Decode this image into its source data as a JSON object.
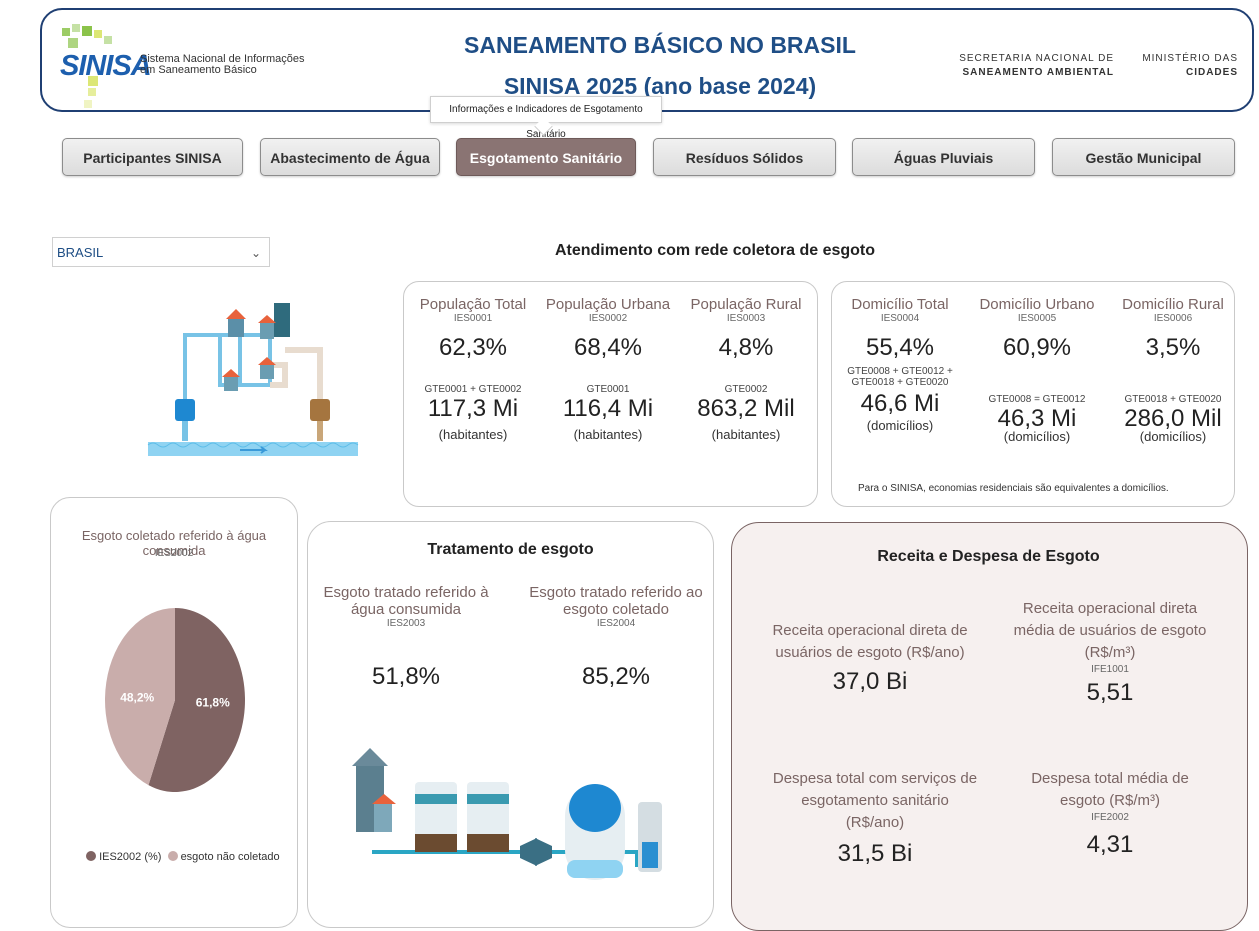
{
  "header": {
    "logo_text": "SINISA",
    "logo_sub1": "Sistema Nacional de Informações",
    "logo_sub2": "em Saneamento Básico",
    "title_line1": "SANEAMENTO BÁSICO NO BRASIL",
    "title_line2": "SINISA 2025 (ano base 2024)",
    "secretaria_line1": "SECRETARIA NACIONAL DE",
    "secretaria_line2": "SANEAMENTO AMBIENTAL",
    "ministerio_line1": "MINISTÉRIO DAS",
    "ministerio_line2": "CIDADES"
  },
  "tooltip": "Informações e Indicadores de Esgotamento Sanitário",
  "tabs": [
    {
      "label": "Participantes SINISA"
    },
    {
      "label": "Abastecimento de Água"
    },
    {
      "label": "Esgotamento Sanitário"
    },
    {
      "label": "Resíduos Sólidos"
    },
    {
      "label": "Águas Pluviais"
    },
    {
      "label": "Gestão Municipal"
    }
  ],
  "filter": {
    "value": "BRASIL"
  },
  "atendimento": {
    "title": "Atendimento com rede coletora de esgoto",
    "populacao": [
      {
        "label": "População Total",
        "code": "IES0001",
        "pct": "62,3%",
        "formula": "GTE0001 + GTE0002",
        "value": "117,3 Mi",
        "unit": "(habitantes)"
      },
      {
        "label": "População Urbana",
        "code": "IES0002",
        "pct": "68,4%",
        "formula": "GTE0001",
        "value": "116,4 Mi",
        "unit": "(habitantes)"
      },
      {
        "label": "População Rural",
        "code": "IES0003",
        "pct": "4,8%",
        "formula": "GTE0002",
        "value": "863,2 Mil",
        "unit": "(habitantes)"
      }
    ],
    "domicilio": [
      {
        "label": "Domicílio Total",
        "code": "IES0004",
        "pct": "55,4%",
        "formula1": "GTE0008 + GTE0012 +",
        "formula2": "GTE0018 + GTE0020",
        "value": "46,6 Mi",
        "unit": "(domicílios)"
      },
      {
        "label": "Domicílio Urbano",
        "code": "IES0005",
        "pct": "60,9%",
        "formula": "GTE0008 = GTE0012",
        "value": "46,3 Mi",
        "unit": "(domicílios)"
      },
      {
        "label": "Domicílio Rural",
        "code": "IES0006",
        "pct": "3,5%",
        "formula": "GTE0018 + GTE0020",
        "value": "286,0 Mil",
        "unit": "(domicílios)"
      }
    ],
    "note": "Para o SINISA, economias residenciais são equivalentes a domicílios."
  },
  "esgoto_coletado": {
    "title": "Esgoto coletado referido à água consumida",
    "code": "IES2002",
    "legend": [
      {
        "label": "IES2002 (%)",
        "color": "#7f6362"
      },
      {
        "label": "esgoto não coletado",
        "color": "#c9adab"
      }
    ]
  },
  "chart_data": {
    "type": "pie",
    "title": "Esgoto coletado referido à água consumida",
    "categories": [
      "IES2002 (%)",
      "esgoto não coletado"
    ],
    "values": [
      61.8,
      48.2
    ],
    "labels": [
      "61,8%",
      "48,2%"
    ],
    "colors": [
      "#7f6362",
      "#c9adab"
    ]
  },
  "tratamento": {
    "title": "Tratamento de esgoto",
    "items": [
      {
        "label1": "Esgoto tratado referido à",
        "label2": "água consumida",
        "code": "IES2003",
        "value": "51,8%"
      },
      {
        "label1": "Esgoto tratado referido ao",
        "label2": "esgoto coletado",
        "code": "IES2004",
        "value": "85,2%"
      }
    ]
  },
  "receita": {
    "title": "Receita e Despesa de Esgoto",
    "items": [
      {
        "line1": "Receita operacional direta de",
        "line2": "usuários de esgoto (R$/ano)",
        "line3": "",
        "code": "",
        "value": "37,0 Bi"
      },
      {
        "line1": "Receita operacional direta",
        "line2": "média de usuários de esgoto",
        "line3": "(R$/m³)",
        "code": "IFE1001",
        "value": "5,51"
      },
      {
        "line1": "Despesa total com serviços de",
        "line2": "esgotamento sanitário",
        "line3": "(R$/ano)",
        "code": "",
        "value": "31,5 Bi"
      },
      {
        "line1": "Despesa total média de",
        "line2": "esgoto (R$/m³)",
        "line3": "",
        "code": "IFE2002",
        "value": "4,31"
      }
    ]
  }
}
